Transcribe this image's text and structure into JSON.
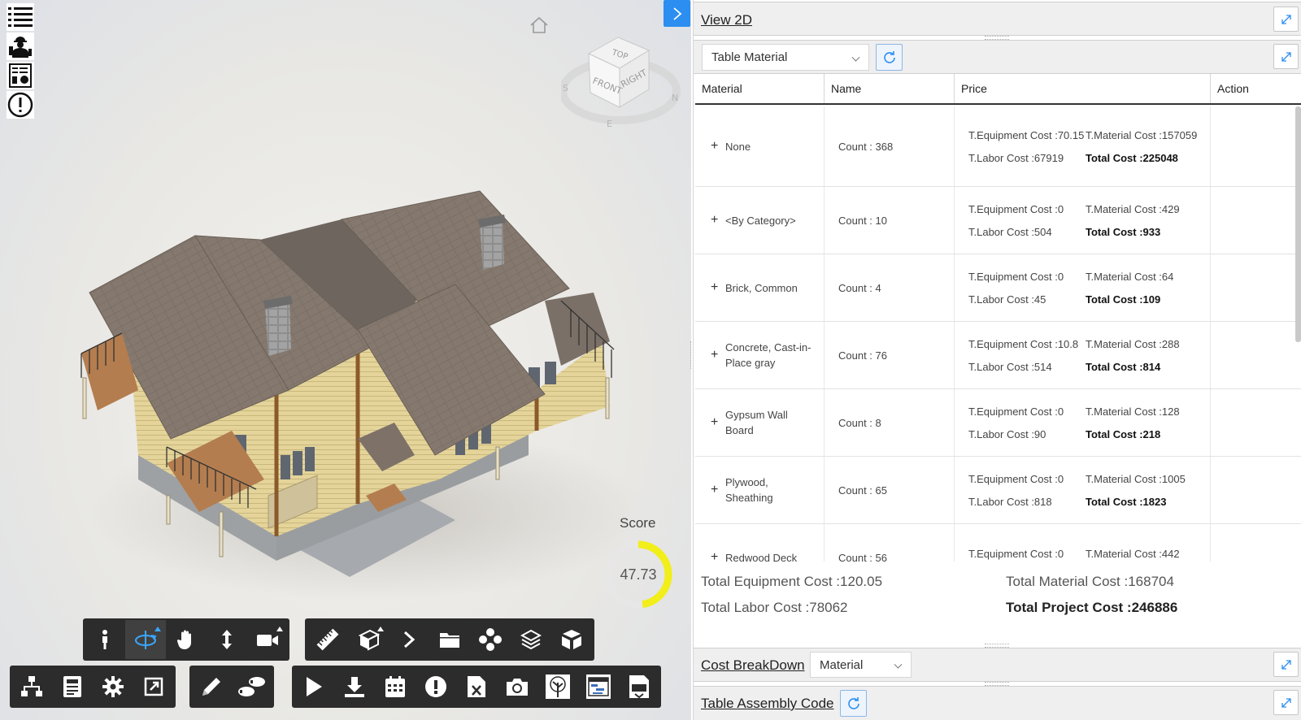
{
  "viewer": {
    "score_label": "Score",
    "score_value": "47.73",
    "score_fraction": 0.4773,
    "viewcube": {
      "top": "TOP",
      "front": "FRONT",
      "right": "RIGHT",
      "s": "S",
      "n": "N",
      "e": "E"
    },
    "left_icons": [
      "list-icon",
      "worker-icon",
      "report-icon",
      "warning-circle-icon"
    ],
    "toolbar_row1_group1": [
      "walk-icon",
      "orbit-icon",
      "pan-icon",
      "zoom-vertical-icon",
      "camera-icon"
    ],
    "toolbar_row1_group2": [
      "ruler-icon",
      "section-box-icon",
      "chevron-right-icon",
      "folder-icon",
      "model-tree-icon",
      "layers-icon",
      "explode-cube-icon"
    ],
    "toolbar_row2_group1": [
      "hierarchy-icon",
      "properties-icon",
      "settings-icon",
      "fullscreen-icon"
    ],
    "toolbar_row2_group2": [
      "pencil-icon",
      "steps-icon"
    ],
    "toolbar_row2_group3": [
      "play-icon",
      "download-icon",
      "calendar-icon",
      "alert-icon",
      "excel-icon",
      "camera-snapshot-icon",
      "tree-icon",
      "schedule-icon",
      "document-icon"
    ]
  },
  "panel": {
    "view2d_title": "View 2D",
    "table_select": "Table Material",
    "columns": [
      "Material",
      "Name",
      "Price",
      "Action"
    ],
    "rows": [
      {
        "material": "None",
        "name": "Count : 368",
        "eq": "T.Equipment Cost :70.15",
        "mat": "T.Material Cost :157059",
        "labor": "T.Labor Cost :67919",
        "total": "Total Cost :225048"
      },
      {
        "material": "<By Category>",
        "name": "Count : 10",
        "eq": "T.Equipment Cost :0",
        "mat": "T.Material Cost :429",
        "labor": "T.Labor Cost :504",
        "total": "Total Cost :933"
      },
      {
        "material": "Brick, Common",
        "name": "Count : 4",
        "eq": "T.Equipment Cost :0",
        "mat": "T.Material Cost :64",
        "labor": "T.Labor Cost :45",
        "total": "Total Cost :109"
      },
      {
        "material": "Concrete, Cast-in-Place gray",
        "name": "Count : 76",
        "eq": "T.Equipment Cost :10.8",
        "mat": "T.Material Cost :288",
        "labor": "T.Labor Cost :514",
        "total": "Total Cost :814"
      },
      {
        "material": "Gypsum Wall Board",
        "name": "Count : 8",
        "eq": "T.Equipment Cost :0",
        "mat": "T.Material Cost :128",
        "labor": "T.Labor Cost :90",
        "total": "Total Cost :218"
      },
      {
        "material": "Plywood, Sheathing",
        "name": "Count : 65",
        "eq": "T.Equipment Cost :0",
        "mat": "T.Material Cost :1005",
        "labor": "T.Labor Cost :818",
        "total": "Total Cost :1823"
      },
      {
        "material": "Redwood Deck",
        "name": "Count : 56",
        "eq": "T.Equipment Cost :0",
        "mat": "T.Material Cost :442",
        "labor": "",
        "total": ""
      }
    ],
    "totals": {
      "equipment": "Total Equipment Cost :120.05",
      "material": "Total Material Cost :168704",
      "labor": "Total Labor Cost :78062",
      "project": "Total Project Cost :246886"
    },
    "cost_breakdown_title": "Cost BreakDown",
    "cost_breakdown_select": "Material",
    "assembly_title": "Table Assembly Code"
  },
  "colors": {
    "accent": "#2b8ef0",
    "score": "#f2ee1a",
    "toolbar": "#2c2c2c"
  }
}
